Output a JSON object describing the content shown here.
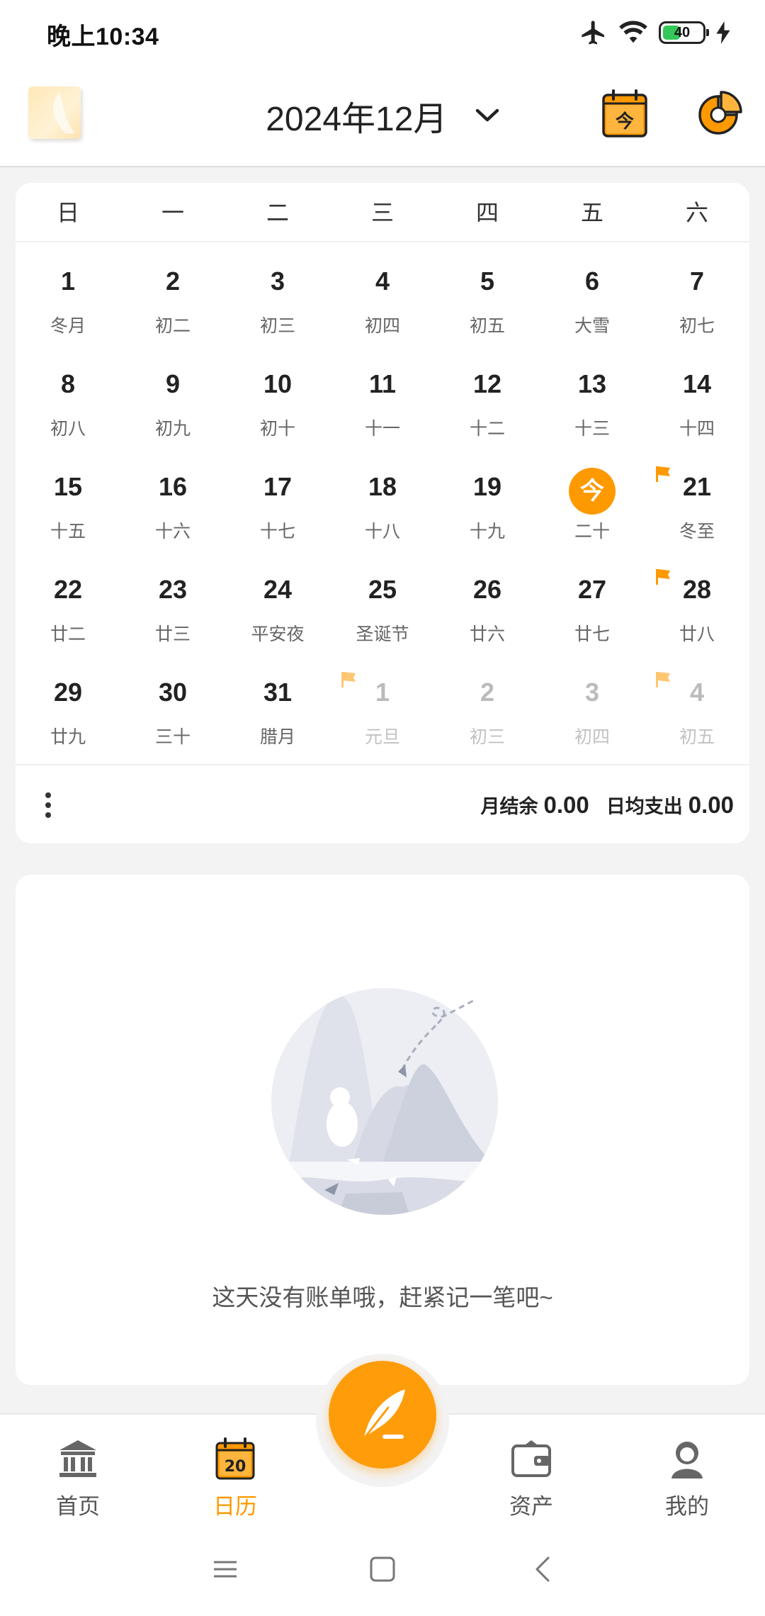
{
  "status_bar": {
    "time": "晚上10:34",
    "battery_level": "40",
    "icons": [
      "airplane-icon",
      "wifi-icon",
      "battery-icon",
      "charging-bolt-icon"
    ]
  },
  "header": {
    "month": "2024年12月",
    "logo": "app-logo",
    "today_icon": "calendar-today-icon",
    "today_icon_label": "今",
    "stats_icon": "pie-chart-icon"
  },
  "calendar": {
    "weekdays": [
      "日",
      "一",
      "二",
      "三",
      "四",
      "五",
      "六"
    ],
    "today_label": "今",
    "selected_day": 20,
    "days": [
      {
        "day": "1",
        "lunar": "冬月"
      },
      {
        "day": "2",
        "lunar": "初二"
      },
      {
        "day": "3",
        "lunar": "初三"
      },
      {
        "day": "4",
        "lunar": "初四"
      },
      {
        "day": "5",
        "lunar": "初五"
      },
      {
        "day": "6",
        "lunar": "大雪"
      },
      {
        "day": "7",
        "lunar": "初七"
      },
      {
        "day": "8",
        "lunar": "初八"
      },
      {
        "day": "9",
        "lunar": "初九"
      },
      {
        "day": "10",
        "lunar": "初十"
      },
      {
        "day": "11",
        "lunar": "十一"
      },
      {
        "day": "12",
        "lunar": "十二"
      },
      {
        "day": "13",
        "lunar": "十三"
      },
      {
        "day": "14",
        "lunar": "十四"
      },
      {
        "day": "15",
        "lunar": "十五"
      },
      {
        "day": "16",
        "lunar": "十六"
      },
      {
        "day": "17",
        "lunar": "十七"
      },
      {
        "day": "18",
        "lunar": "十八"
      },
      {
        "day": "19",
        "lunar": "十九"
      },
      {
        "day": "20",
        "lunar": "二十",
        "today": true
      },
      {
        "day": "21",
        "lunar": "冬至",
        "flag": true
      },
      {
        "day": "22",
        "lunar": "廿二"
      },
      {
        "day": "23",
        "lunar": "廿三"
      },
      {
        "day": "24",
        "lunar": "平安夜"
      },
      {
        "day": "25",
        "lunar": "圣诞节"
      },
      {
        "day": "26",
        "lunar": "廿六"
      },
      {
        "day": "27",
        "lunar": "廿七"
      },
      {
        "day": "28",
        "lunar": "廿八",
        "flag": true
      },
      {
        "day": "29",
        "lunar": "廿九"
      },
      {
        "day": "30",
        "lunar": "三十"
      },
      {
        "day": "31",
        "lunar": "腊月"
      },
      {
        "day": "1",
        "lunar": "元旦",
        "other": true,
        "flag": true
      },
      {
        "day": "2",
        "lunar": "初三",
        "other": true
      },
      {
        "day": "3",
        "lunar": "初四",
        "other": true
      },
      {
        "day": "4",
        "lunar": "初五",
        "other": true,
        "flag": true
      }
    ],
    "flag_color": "#ff9900",
    "accent_color": "#ff9900"
  },
  "summary": {
    "balance_label": "月结余",
    "balance_value": "0.00",
    "avg_label": "日均支出",
    "avg_value": "0.00"
  },
  "empty_state": {
    "message": "这天没有账单哦，赶紧记一笔吧~",
    "illustration": "empty-bills-illustration"
  },
  "bottom_nav": {
    "items": [
      {
        "label": "首页",
        "icon": "bank-icon"
      },
      {
        "label": "日历",
        "icon": "calendar-icon",
        "icon_text": "20",
        "active": true
      },
      {
        "label": "资产",
        "icon": "wallet-icon"
      },
      {
        "label": "我的",
        "icon": "user-icon"
      }
    ],
    "fab_icon": "quill-pen-icon"
  },
  "system_nav": {
    "buttons": [
      "menu-icon",
      "home-icon",
      "back-icon"
    ]
  }
}
